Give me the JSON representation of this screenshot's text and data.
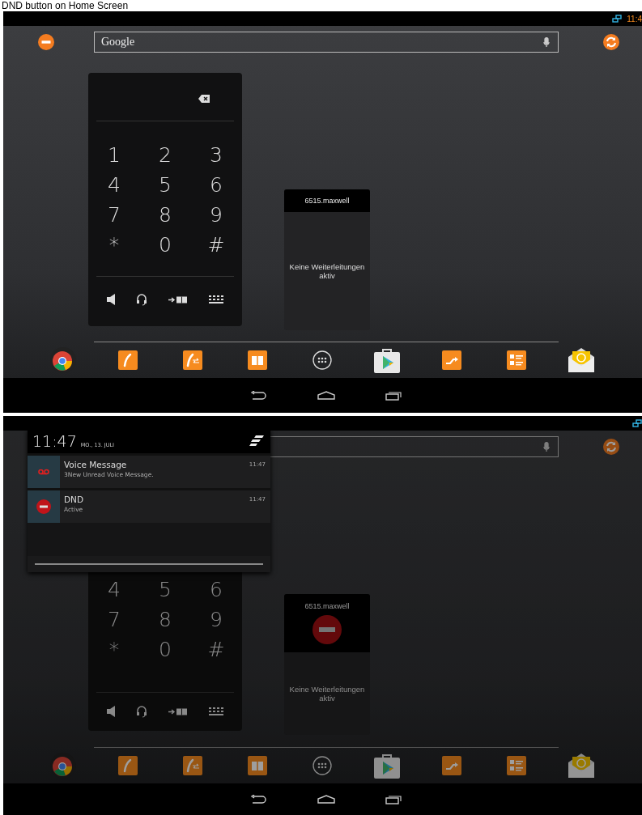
{
  "caption": "DND button on Home Screen",
  "screens": [
    {
      "dimmed": false,
      "status": {
        "clock": "11:4"
      },
      "dnd_button": true,
      "search": {
        "placeholder": "Google"
      },
      "dialer": {
        "backspace": true,
        "keys": [
          "1",
          "2",
          "3",
          "4",
          "5",
          "6",
          "7",
          "8",
          "9",
          "*",
          "0",
          "#"
        ]
      },
      "forwarding": {
        "account": "6515.maxwell",
        "dnd_active": false,
        "message": "Keine Weiterleitungen aktiv"
      },
      "dock": [
        {
          "kind": "browser"
        },
        {
          "kind": "phone"
        },
        {
          "kind": "phone-transfer"
        },
        {
          "kind": "book"
        },
        {
          "kind": "apps"
        },
        {
          "kind": "store"
        },
        {
          "kind": "forward"
        },
        {
          "kind": "list"
        },
        {
          "kind": "mail"
        }
      ]
    },
    {
      "dimmed": true,
      "dialer": {
        "keys": [
          "4",
          "5",
          "6",
          "7",
          "8",
          "9",
          "*",
          "0",
          "#"
        ]
      },
      "forwarding": {
        "account": "6515.maxwell",
        "dnd_active": true,
        "message": "Keine Weiterleitungen aktiv"
      },
      "dock": [
        {
          "kind": "browser"
        },
        {
          "kind": "phone"
        },
        {
          "kind": "phone-transfer"
        },
        {
          "kind": "book"
        },
        {
          "kind": "apps"
        },
        {
          "kind": "store"
        },
        {
          "kind": "forward"
        },
        {
          "kind": "list"
        },
        {
          "kind": "mail"
        }
      ],
      "notification_panel": {
        "time": "11:47",
        "date": "MO., 13. JULI",
        "notifications": [
          {
            "kind": "voicemail",
            "title": "Voice Message",
            "text": "3New Unread Voice Message.",
            "time": "11:47"
          },
          {
            "kind": "dnd",
            "title": "DND",
            "text": "Active",
            "time": "11:47"
          }
        ]
      }
    }
  ]
}
